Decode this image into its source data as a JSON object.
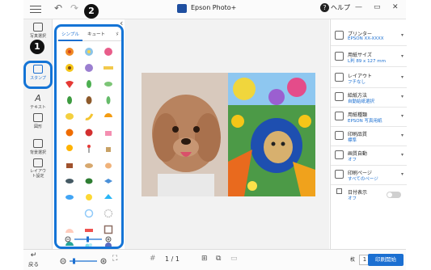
{
  "titlebar": {
    "app_title": "Epson Photo+",
    "help_label": "ヘルプ",
    "undo_icon": "undo-icon",
    "redo_icon": "redo-icon"
  },
  "rail": {
    "items": [
      {
        "label": "写真選択",
        "icon": "photo-select-icon"
      },
      {
        "label": "スタンプ",
        "icon": "stamp-icon",
        "active": true
      },
      {
        "label": "テキスト",
        "icon": "text-icon"
      },
      {
        "label": "図形",
        "icon": "shape-icon"
      },
      {
        "label": "背景選択",
        "icon": "background-icon"
      },
      {
        "label": "レイアウト設定",
        "icon": "layout-icon"
      }
    ]
  },
  "stamp_panel": {
    "tabs": [
      "シンプル",
      "キュート",
      "ゞ"
    ],
    "active_tab": 0
  },
  "callouts": {
    "one": "1",
    "two": "2"
  },
  "settings": {
    "items": [
      {
        "label": "プリンター",
        "value": "EPSON XX-XXXX"
      },
      {
        "label": "用紙サイズ",
        "value": "L判 89 x 127 mm"
      },
      {
        "label": "レイアウト",
        "value": "フチなし"
      },
      {
        "label": "給紙方法",
        "value": "自動給紙選択"
      },
      {
        "label": "用紙種類",
        "value": "EPSON 写真用紙"
      },
      {
        "label": "印刷品質",
        "value": "標準"
      },
      {
        "label": "画質自動",
        "value": "オフ"
      },
      {
        "label": "印刷ページ",
        "value": "すべてのページ"
      },
      {
        "label": "日付表示",
        "value": "オフ"
      }
    ]
  },
  "bottombar": {
    "back_label": "戻る",
    "page_current": "1",
    "page_sep": "/",
    "page_total": "1",
    "copies": "1",
    "copies_unit": "枚",
    "print_label": "印刷開始"
  },
  "colors": {
    "accent": "#1b6fd1",
    "callout_border": "#1474d6"
  }
}
